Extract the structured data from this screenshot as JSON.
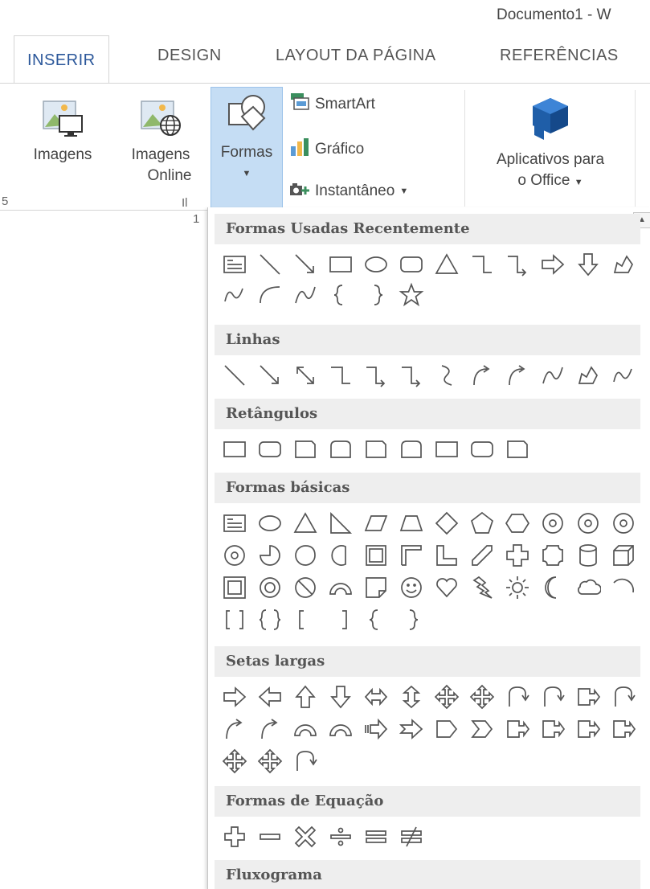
{
  "window": {
    "title": "Documento1 - W"
  },
  "tabs": [
    {
      "label": "INSERIR",
      "active": true
    },
    {
      "label": "DESIGN"
    },
    {
      "label": "LAYOUT DA PÁGINA"
    },
    {
      "label": "REFERÊNCIAS"
    }
  ],
  "ribbon": {
    "imagens_label": "Imagens",
    "imagens_online_line1": "Imagens",
    "imagens_online_line2": "Online",
    "formas_label": "Formas",
    "smartart_label": "SmartArt",
    "grafico_label": "Gráfico",
    "instantaneo_label": "Instantâneo",
    "aplicativos_line1": "Aplicativos para",
    "aplicativos_line2": "o Office",
    "group_label_fragment": "Il",
    "left_fragment": "5",
    "below_fragment": "1"
  },
  "gallery": {
    "sections": [
      "Formas Usadas Recentemente",
      "Linhas",
      "Retângulos",
      "Formas básicas",
      "Setas largas",
      "Formas de Equação",
      "Fluxograma"
    ]
  },
  "colors": {
    "accent": "#2b579a",
    "selected_bg": "#c5ddf4",
    "header_bg": "#eeeeee"
  }
}
